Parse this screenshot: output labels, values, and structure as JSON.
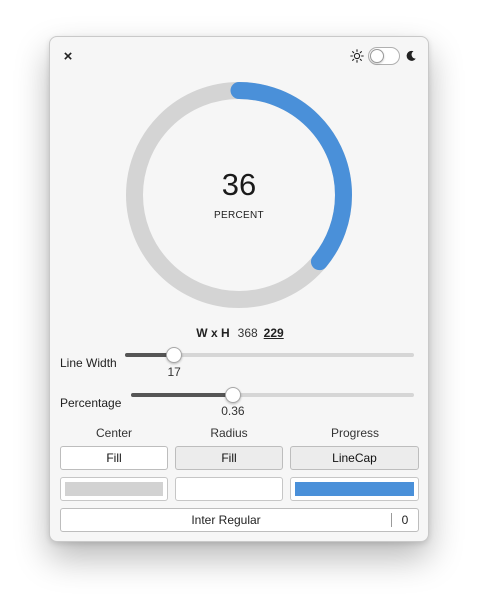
{
  "window": {
    "close_glyph": "×"
  },
  "theme": {
    "mode": "light",
    "sun_icon": "sun-icon",
    "moon_icon": "moon-icon"
  },
  "ring": {
    "value": "36",
    "unit": "PERCENT",
    "progress": 0.36,
    "track_color": "#d4d4d4",
    "progress_color": "#4a90d9"
  },
  "size": {
    "label": "W x H",
    "width": "368",
    "height": "229"
  },
  "line_width": {
    "label": "Line Width",
    "value": "17",
    "fraction": 0.17
  },
  "percentage": {
    "label": "Percentage",
    "value": "0.36",
    "fraction": 0.36
  },
  "columns": {
    "center": {
      "heading": "Center",
      "button": "Fill",
      "swatch_color": "#d2d2d2"
    },
    "radius": {
      "heading": "Radius",
      "button": "Fill",
      "swatch_color": "#ffffff"
    },
    "progress": {
      "heading": "Progress",
      "button": "LineCap",
      "swatch_color": "#4a90d9"
    }
  },
  "font": {
    "name": "Inter Regular",
    "size": "0"
  }
}
